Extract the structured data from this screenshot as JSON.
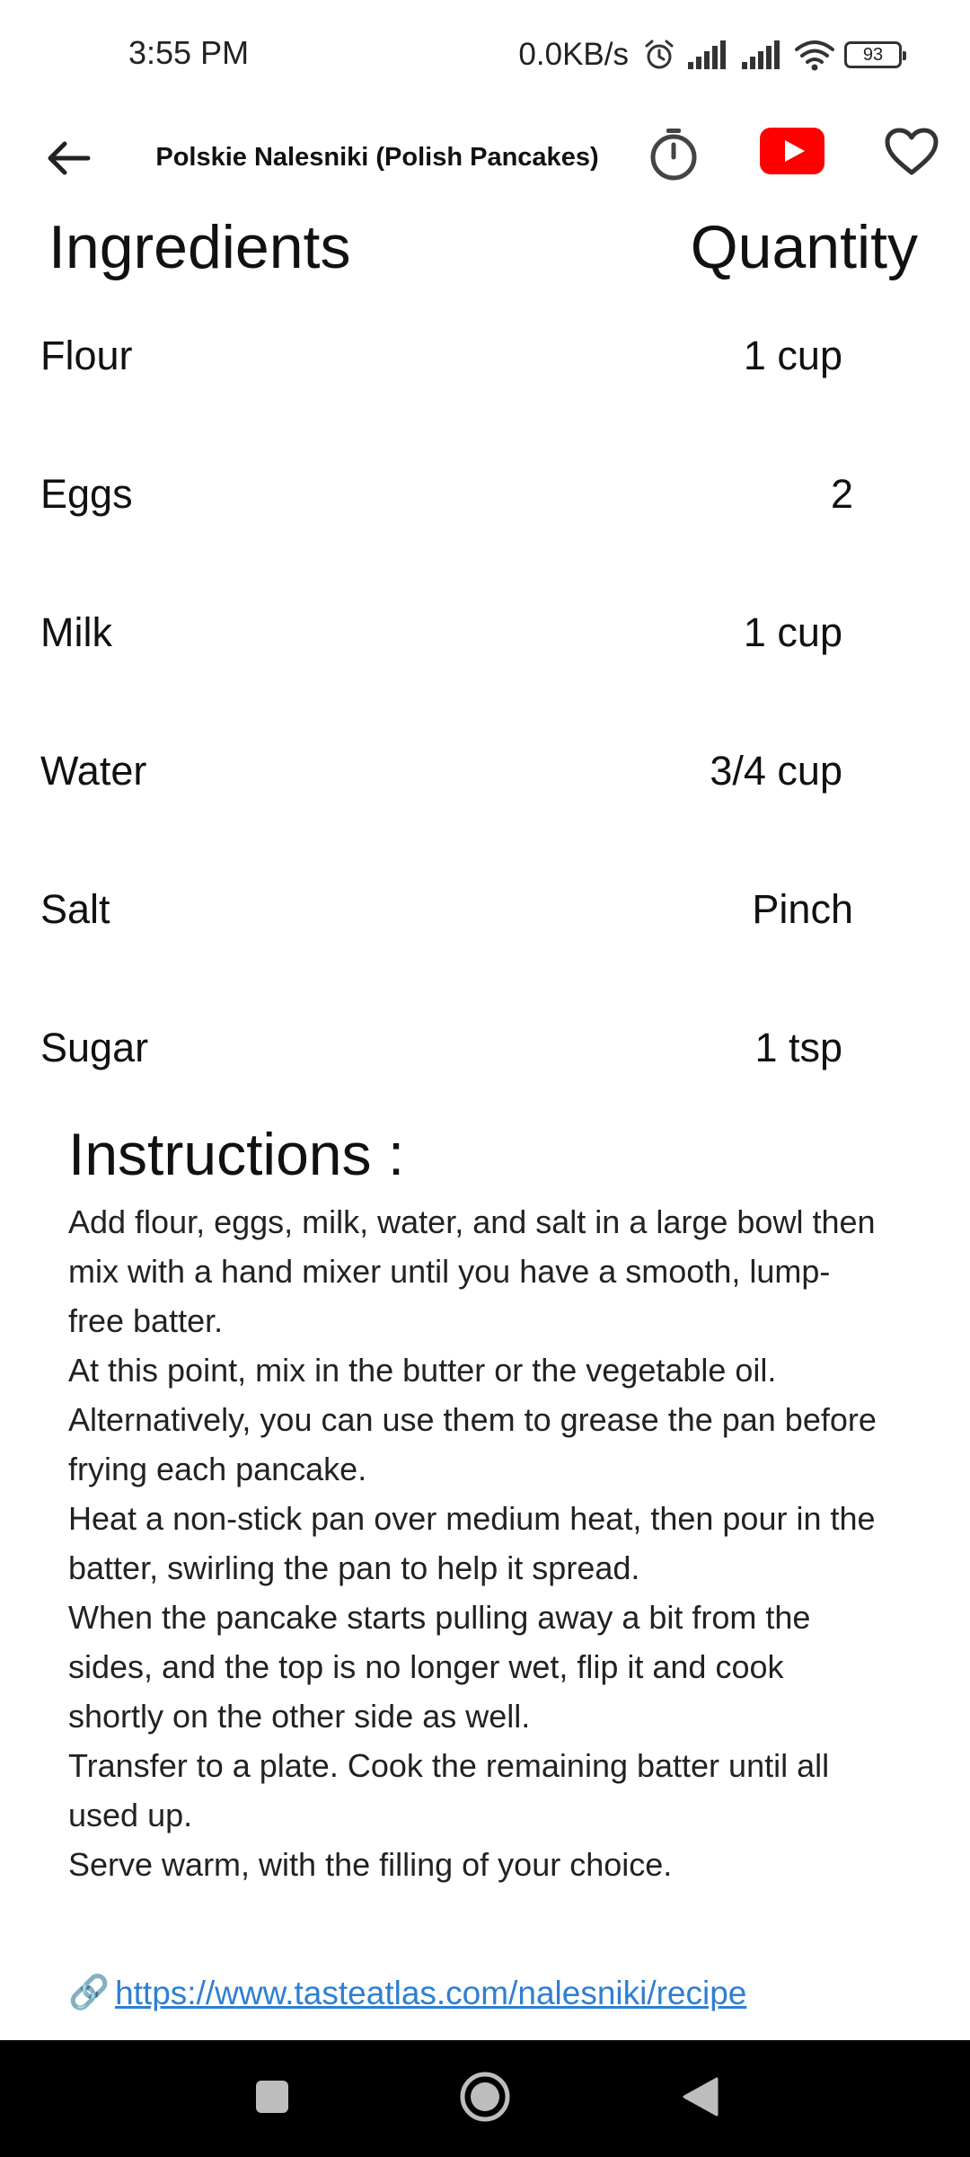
{
  "status_bar": {
    "time": "3:55 PM",
    "net_speed": "0.0KB/s",
    "battery": "93"
  },
  "app_bar": {
    "title": "Polskie Nalesniki (Polish Pancakes)",
    "icons": [
      "back-arrow-icon",
      "timer-icon",
      "youtube-icon",
      "heart-icon"
    ]
  },
  "table": {
    "ingredients_header": "Ingredients",
    "quantity_header": "Quantity",
    "rows": [
      {
        "name": "Flour",
        "qty": "1 cup"
      },
      {
        "name": "Eggs",
        "qty": "2"
      },
      {
        "name": "Milk",
        "qty": "1 cup"
      },
      {
        "name": "Water",
        "qty": "3/4 cup"
      },
      {
        "name": "Salt",
        "qty": "Pinch"
      },
      {
        "name": "Sugar",
        "qty": "1 tsp"
      }
    ]
  },
  "instructions": {
    "title": "Instructions :",
    "steps": [
      "Add flour, eggs, milk, water, and salt in a large bowl then mix with a hand mixer until you have a smooth, lump-free batter.",
      "At this point, mix in the butter or the vegetable oil. Alternatively, you can use them to grease the pan before frying each pancake.",
      "Heat a non-stick pan over medium heat, then pour in the batter, swirling the pan to help it spread.",
      "When the pancake starts pulling away a bit from the sides, and the top is no longer wet, flip it and cook shortly on the other side as well.",
      "Transfer to a plate. Cook the remaining batter until all used up.",
      "Serve warm, with the filling of your choice."
    ]
  },
  "source": {
    "link_icon": "🔗",
    "url": "https://www.tasteatlas.com/nalesniki/recipe"
  },
  "colors": {
    "youtube_red": "#ff0000",
    "link_blue": "#2f7fd2",
    "nav_bar": "#000000"
  }
}
